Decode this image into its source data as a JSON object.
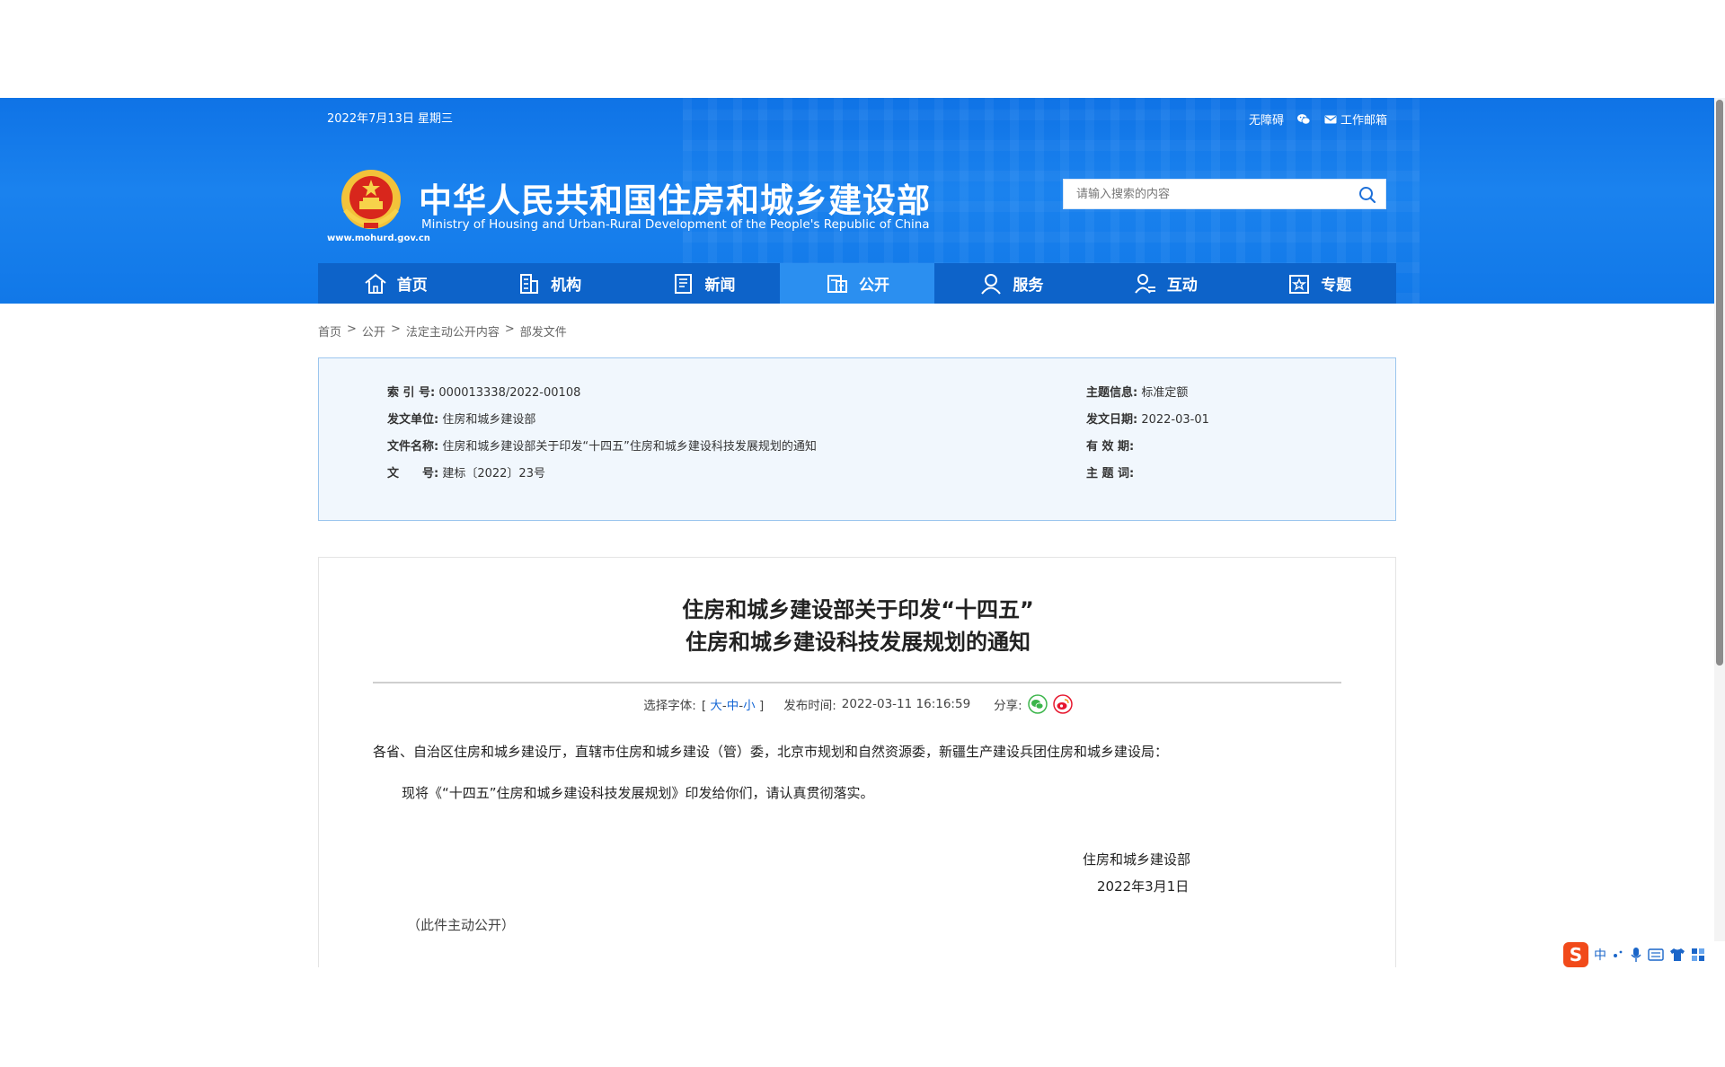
{
  "header": {
    "date": "2022年7月13日 星期三",
    "top_links": [
      {
        "label": "无障碍"
      },
      {
        "label": "工作邮箱"
      }
    ],
    "site_url": "www.mohurd.gov.cn",
    "title_cn": "中华人民共和国住房和城乡建设部",
    "title_en": "Ministry of Housing and Urban-Rural Development of the People's Republic of China",
    "search_placeholder": "请输入搜索的内容",
    "colors": {
      "header_blue": "#1178e8",
      "nav_blue": "#0d63c9",
      "nav_active": "#2b8ff0"
    }
  },
  "nav": {
    "items": [
      {
        "label": "首页",
        "icon": "home-icon"
      },
      {
        "label": "机构",
        "icon": "building-icon"
      },
      {
        "label": "新闻",
        "icon": "news-icon"
      },
      {
        "label": "公开",
        "icon": "disclosure-icon",
        "active": true
      },
      {
        "label": "服务",
        "icon": "service-icon"
      },
      {
        "label": "互动",
        "icon": "interaction-icon"
      },
      {
        "label": "专题",
        "icon": "topic-icon"
      }
    ]
  },
  "breadcrumb": {
    "items": [
      "首页",
      "公开",
      "法定主动公开内容",
      "部发文件"
    ],
    "separator": ">"
  },
  "info": {
    "index_label": "索 引 号:",
    "index_value": "000013338/2022-00108",
    "issuer_label": "发文单位:",
    "issuer_value": "住房和城乡建设部",
    "doc_name_label": "文件名称:",
    "doc_name_value": "住房和城乡建设部关于印发“十四五”住房和城乡建设科技发展规划的通知",
    "doc_no_label": "文　　号:",
    "doc_no_value": "建标〔2022〕23号",
    "topic_label": "主题信息:",
    "topic_value": "标准定额",
    "date_label": "发文日期:",
    "date_value": "2022-03-01",
    "validity_label": "有 效 期:",
    "validity_value": "",
    "keywords_label": "主 题 词:",
    "keywords_value": ""
  },
  "article": {
    "title_line1": "住房和城乡建设部关于印发“十四五”",
    "title_line2": "住房和城乡建设科技发展规划的通知",
    "font_select_label": "选择字体:",
    "font_open": "[",
    "font_large": "大",
    "font_medium": "中",
    "font_small": "小",
    "font_sep": "-",
    "font_close": "]",
    "publish_label": "发布时间:",
    "publish_time": "2022-03-11 16:16:59",
    "share_label": "分享:",
    "salutation": "各省、自治区住房和城乡建设厅，直辖市住房和城乡建设（管）委，北京市规划和自然资源委，新疆生产建设兵团住房和城乡建设局：",
    "paragraph1": "现将《“十四五”住房和城乡建设科技发展规划》印发给你们，请认真贯彻落实。",
    "signature": "住房和城乡建设部",
    "sign_date": "2022年3月1日",
    "note": "（此件主动公开）"
  },
  "ime": {
    "logo": "S",
    "lang": "中"
  }
}
